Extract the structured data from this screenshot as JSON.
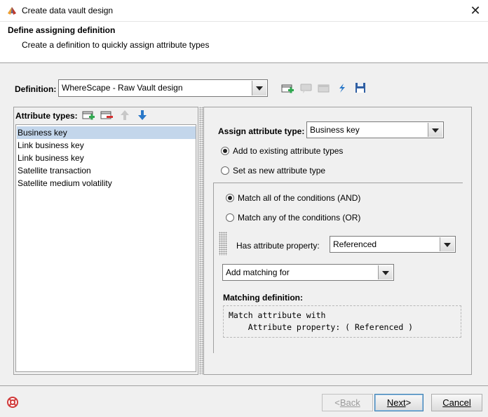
{
  "window": {
    "title": "Create data vault design"
  },
  "header": {
    "title": "Define assigning definition",
    "subtitle": "Create a definition to quickly assign attribute types"
  },
  "definition": {
    "label": "Definition:",
    "value": "WhereScape - Raw Vault design"
  },
  "toolbar_icons": [
    "add-definition-icon",
    "comment-icon",
    "rename-icon",
    "refresh-icon",
    "save-icon"
  ],
  "attribute_types": {
    "label": "Attribute types:",
    "items": [
      "Business key",
      "Link business key",
      "Link business key",
      "Satellite transaction",
      "Satellite medium volatility"
    ],
    "selected_index": 0,
    "icons": [
      "add-icon",
      "remove-icon",
      "move-up-icon",
      "move-down-icon"
    ]
  },
  "assign": {
    "label": "Assign attribute type:",
    "value": "Business key",
    "option_existing": "Add to existing attribute types",
    "option_new": "Set as new attribute type",
    "selected": "existing"
  },
  "conditions": {
    "option_all": "Match all of the conditions (AND)",
    "option_any": "Match any of the conditions (OR)",
    "selected": "all",
    "property_label": "Has attribute property:",
    "property_value": "Referenced",
    "add_matching": "Add matching for"
  },
  "matching": {
    "label": "Matching definition:",
    "line1": "Match attribute with",
    "line2": "    Attribute property: ( Referenced )"
  },
  "footer": {
    "back_prefix": "< ",
    "back_label": "Back",
    "next_label": "Next",
    "next_suffix": " >",
    "cancel_label": "Cancel"
  },
  "colors": {
    "selection": "#c3d6eb",
    "dialog_bg": "#f0f0f0",
    "accent_blue": "#2a78c8"
  }
}
